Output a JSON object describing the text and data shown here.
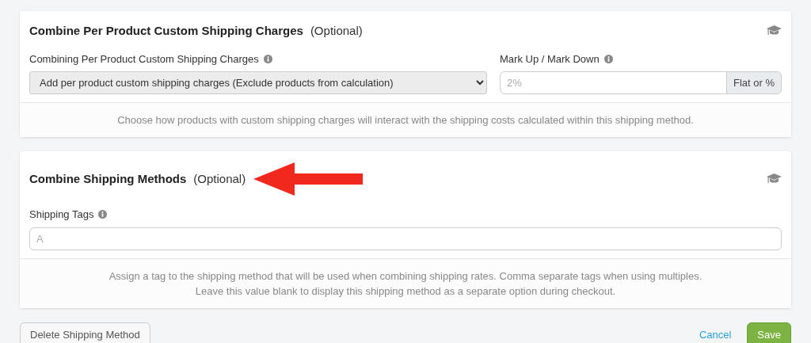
{
  "sections": [
    {
      "title": "Combine Per Product Custom Shipping Charges",
      "optional": "(Optional)",
      "annotation_arrow": false,
      "fields": [
        {
          "kind": "select",
          "label": "Combining Per Product Custom Shipping Charges",
          "value": "Add per product custom shipping charges (Exclude products from calculation)"
        },
        {
          "kind": "addon-input",
          "label": "Mark Up / Mark Down",
          "placeholder": "2%",
          "addon": "Flat or %"
        }
      ],
      "help": [
        "Choose how products with custom shipping charges will interact with the shipping costs calculated within this shipping method."
      ]
    },
    {
      "title": "Combine Shipping Methods",
      "optional": "(Optional)",
      "annotation_arrow": true,
      "fields": [
        {
          "kind": "input",
          "label": "Shipping Tags",
          "placeholder": "A"
        }
      ],
      "help": [
        "Assign a tag to the shipping method that will be used when combining shipping rates. Comma separate tags when using multiples.",
        "Leave this value blank to display this shipping method as a separate option during checkout."
      ]
    }
  ],
  "actions": {
    "delete": "Delete Shipping Method",
    "cancel": "Cancel",
    "save": "Save"
  }
}
